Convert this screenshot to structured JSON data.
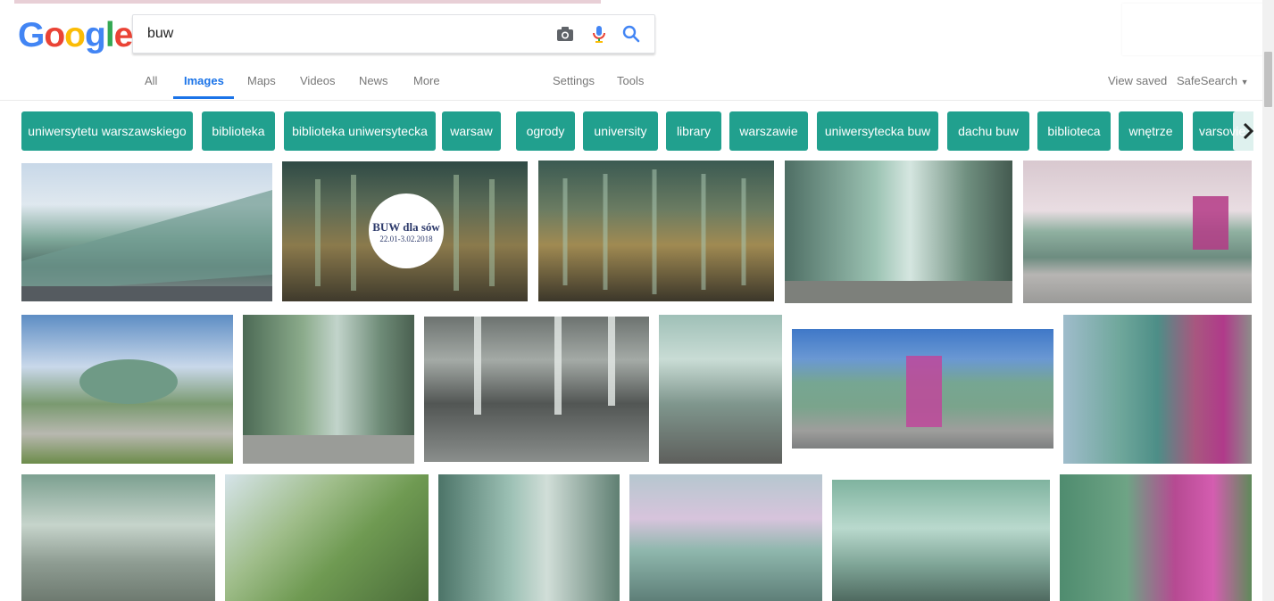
{
  "logo": {
    "letters": [
      "G",
      "o",
      "o",
      "g",
      "l",
      "e"
    ],
    "colors": [
      "#4285f4",
      "#ea4335",
      "#fbbc05",
      "#4285f4",
      "#34a853",
      "#ea4335"
    ]
  },
  "search": {
    "query": "buw"
  },
  "nav": {
    "tabs": [
      "All",
      "Images",
      "Maps",
      "Videos",
      "News",
      "More"
    ],
    "active": "Images",
    "settings": "Settings",
    "tools": "Tools",
    "view_saved": "View saved",
    "safesearch": "SafeSearch"
  },
  "chips": [
    "uniwersytetu warszawskiego",
    "biblioteka",
    "biblioteka uniwersytecka",
    "warsaw",
    "ogrody",
    "university",
    "library",
    "warszawie",
    "uniwersytecka buw",
    "dachu buw",
    "biblioteca",
    "wnętrze",
    "varsovie"
  ],
  "overlay": {
    "title": "BUW dla sów",
    "dates": "22.01-3.02.2018"
  },
  "colors": {
    "accent": "#1a73e8",
    "chip": "#21a08e"
  }
}
